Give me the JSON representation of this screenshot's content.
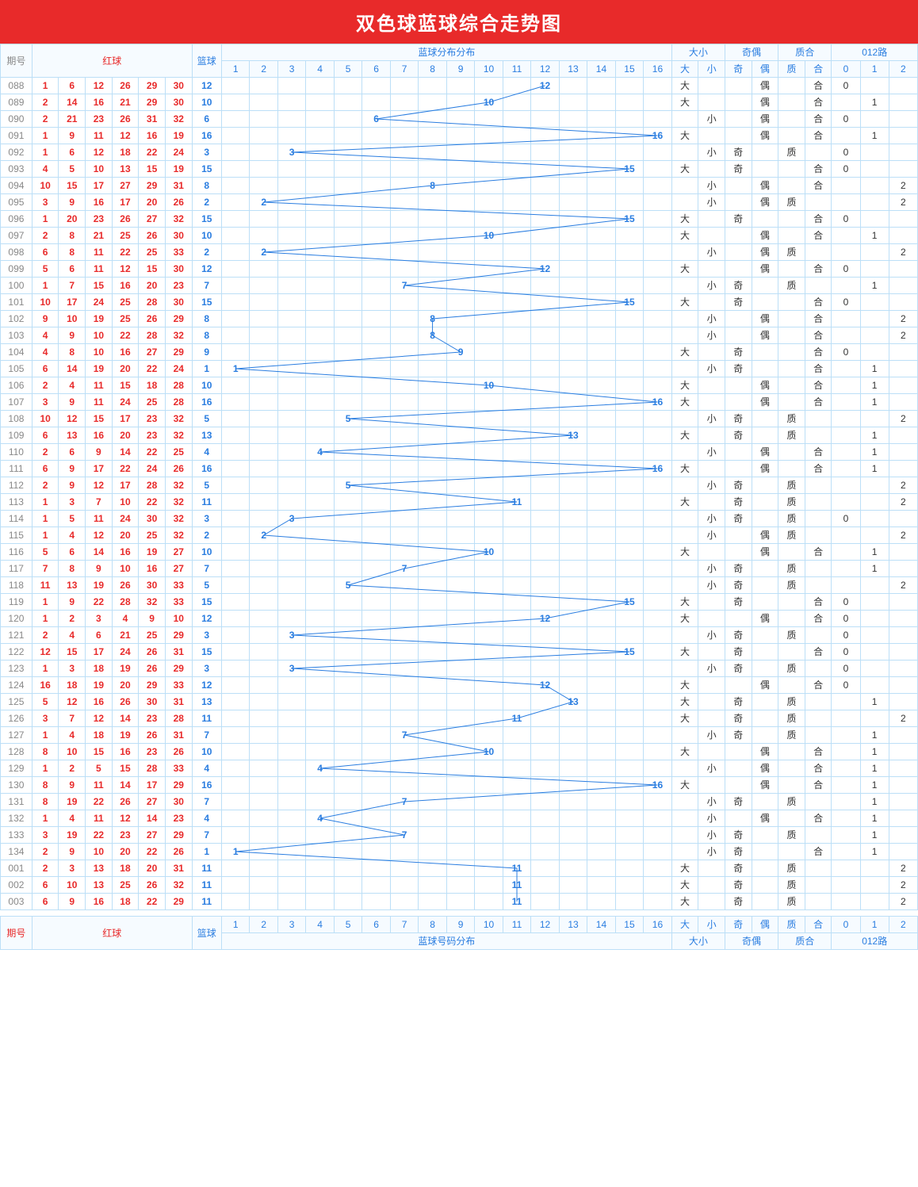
{
  "title": "双色球蓝球综合走势图",
  "headers": {
    "period": "期号",
    "red": "红球",
    "blue": "篮球",
    "distGroup": "蓝球分布分布",
    "distFooter": "蓝球号码分布",
    "dx": "大小",
    "dxBig": "大",
    "dxSmall": "小",
    "qo": "奇偶",
    "qoOdd": "奇",
    "qoEven": "偶",
    "zh": "质合",
    "zhPrime": "质",
    "zhComp": "合",
    "p012": "012路",
    "p0": "0",
    "p1": "1",
    "p2": "2"
  },
  "distCols": [
    "1",
    "2",
    "3",
    "4",
    "5",
    "6",
    "7",
    "8",
    "9",
    "10",
    "11",
    "12",
    "13",
    "14",
    "15",
    "16"
  ],
  "chart_data": {
    "type": "table",
    "title": "双色球蓝球综合走势图",
    "columns": [
      "期号",
      "红1",
      "红2",
      "红3",
      "红4",
      "红5",
      "红6",
      "蓝球",
      "大小",
      "奇偶",
      "质合",
      "012路"
    ],
    "rows": [
      {
        "period": "088",
        "red": [
          1,
          6,
          12,
          26,
          29,
          30
        ],
        "blue": 12,
        "dx": "大",
        "qo": "偶",
        "zh": "合",
        "p012": "0"
      },
      {
        "period": "089",
        "red": [
          2,
          14,
          16,
          21,
          29,
          30
        ],
        "blue": 10,
        "dx": "大",
        "qo": "偶",
        "zh": "合",
        "p012": "1"
      },
      {
        "period": "090",
        "red": [
          2,
          21,
          23,
          26,
          31,
          32
        ],
        "blue": 6,
        "dx": "小",
        "qo": "偶",
        "zh": "合",
        "p012": "0"
      },
      {
        "period": "091",
        "red": [
          1,
          9,
          11,
          12,
          16,
          19
        ],
        "blue": 16,
        "dx": "大",
        "qo": "偶",
        "zh": "合",
        "p012": "1"
      },
      {
        "period": "092",
        "red": [
          1,
          6,
          12,
          18,
          22,
          24
        ],
        "blue": 3,
        "dx": "小",
        "qo": "奇",
        "zh": "质",
        "p012": "0"
      },
      {
        "period": "093",
        "red": [
          4,
          5,
          10,
          13,
          15,
          19
        ],
        "blue": 15,
        "dx": "大",
        "qo": "奇",
        "zh": "合",
        "p012": "0"
      },
      {
        "period": "094",
        "red": [
          10,
          15,
          17,
          27,
          29,
          31
        ],
        "blue": 8,
        "dx": "小",
        "qo": "偶",
        "zh": "合",
        "p012": "2"
      },
      {
        "period": "095",
        "red": [
          3,
          9,
          16,
          17,
          20,
          26
        ],
        "blue": 2,
        "dx": "小",
        "qo": "偶",
        "zh": "质",
        "p012": "2"
      },
      {
        "period": "096",
        "red": [
          1,
          20,
          23,
          26,
          27,
          32
        ],
        "blue": 15,
        "dx": "大",
        "qo": "奇",
        "zh": "合",
        "p012": "0"
      },
      {
        "period": "097",
        "red": [
          2,
          8,
          21,
          25,
          26,
          30
        ],
        "blue": 10,
        "dx": "大",
        "qo": "偶",
        "zh": "合",
        "p012": "1"
      },
      {
        "period": "098",
        "red": [
          6,
          8,
          11,
          22,
          25,
          33
        ],
        "blue": 2,
        "dx": "小",
        "qo": "偶",
        "zh": "质",
        "p012": "2"
      },
      {
        "period": "099",
        "red": [
          5,
          6,
          11,
          12,
          15,
          30
        ],
        "blue": 12,
        "dx": "大",
        "qo": "偶",
        "zh": "合",
        "p012": "0"
      },
      {
        "period": "100",
        "red": [
          1,
          7,
          15,
          16,
          20,
          23
        ],
        "blue": 7,
        "dx": "小",
        "qo": "奇",
        "zh": "质",
        "p012": "1"
      },
      {
        "period": "101",
        "red": [
          10,
          17,
          24,
          25,
          28,
          30
        ],
        "blue": 15,
        "dx": "大",
        "qo": "奇",
        "zh": "合",
        "p012": "0"
      },
      {
        "period": "102",
        "red": [
          9,
          10,
          19,
          25,
          26,
          29
        ],
        "blue": 8,
        "dx": "小",
        "qo": "偶",
        "zh": "合",
        "p012": "2"
      },
      {
        "period": "103",
        "red": [
          4,
          9,
          10,
          22,
          28,
          32
        ],
        "blue": 8,
        "dx": "小",
        "qo": "偶",
        "zh": "合",
        "p012": "2"
      },
      {
        "period": "104",
        "red": [
          4,
          8,
          10,
          16,
          27,
          29
        ],
        "blue": 9,
        "dx": "大",
        "qo": "奇",
        "zh": "合",
        "p012": "0"
      },
      {
        "period": "105",
        "red": [
          6,
          14,
          19,
          20,
          22,
          24
        ],
        "blue": 1,
        "dx": "小",
        "qo": "奇",
        "zh": "合",
        "p012": "1"
      },
      {
        "period": "106",
        "red": [
          2,
          4,
          11,
          15,
          18,
          28
        ],
        "blue": 10,
        "dx": "大",
        "qo": "偶",
        "zh": "合",
        "p012": "1"
      },
      {
        "period": "107",
        "red": [
          3,
          9,
          11,
          24,
          25,
          28
        ],
        "blue": 16,
        "dx": "大",
        "qo": "偶",
        "zh": "合",
        "p012": "1"
      },
      {
        "period": "108",
        "red": [
          10,
          12,
          15,
          17,
          23,
          32
        ],
        "blue": 5,
        "dx": "小",
        "qo": "奇",
        "zh": "质",
        "p012": "2"
      },
      {
        "period": "109",
        "red": [
          6,
          13,
          16,
          20,
          23,
          32
        ],
        "blue": 13,
        "dx": "大",
        "qo": "奇",
        "zh": "质",
        "p012": "1"
      },
      {
        "period": "110",
        "red": [
          2,
          6,
          9,
          14,
          22,
          25
        ],
        "blue": 4,
        "dx": "小",
        "qo": "偶",
        "zh": "合",
        "p012": "1"
      },
      {
        "period": "111",
        "red": [
          6,
          9,
          17,
          22,
          24,
          26
        ],
        "blue": 16,
        "dx": "大",
        "qo": "偶",
        "zh": "合",
        "p012": "1"
      },
      {
        "period": "112",
        "red": [
          2,
          9,
          12,
          17,
          28,
          32
        ],
        "blue": 5,
        "dx": "小",
        "qo": "奇",
        "zh": "质",
        "p012": "2"
      },
      {
        "period": "113",
        "red": [
          1,
          3,
          7,
          10,
          22,
          32
        ],
        "blue": 11,
        "dx": "大",
        "qo": "奇",
        "zh": "质",
        "p012": "2"
      },
      {
        "period": "114",
        "red": [
          1,
          5,
          11,
          24,
          30,
          32
        ],
        "blue": 3,
        "dx": "小",
        "qo": "奇",
        "zh": "质",
        "p012": "0"
      },
      {
        "period": "115",
        "red": [
          1,
          4,
          12,
          20,
          25,
          32
        ],
        "blue": 2,
        "dx": "小",
        "qo": "偶",
        "zh": "质",
        "p012": "2"
      },
      {
        "period": "116",
        "red": [
          5,
          6,
          14,
          16,
          19,
          27
        ],
        "blue": 10,
        "dx": "大",
        "qo": "偶",
        "zh": "合",
        "p012": "1"
      },
      {
        "period": "117",
        "red": [
          7,
          8,
          9,
          10,
          16,
          27
        ],
        "blue": 7,
        "dx": "小",
        "qo": "奇",
        "zh": "质",
        "p012": "1"
      },
      {
        "period": "118",
        "red": [
          11,
          13,
          19,
          26,
          30,
          33
        ],
        "blue": 5,
        "dx": "小",
        "qo": "奇",
        "zh": "质",
        "p012": "2"
      },
      {
        "period": "119",
        "red": [
          1,
          9,
          22,
          28,
          32,
          33
        ],
        "blue": 15,
        "dx": "大",
        "qo": "奇",
        "zh": "合",
        "p012": "0"
      },
      {
        "period": "120",
        "red": [
          1,
          2,
          3,
          4,
          9,
          10
        ],
        "blue": 12,
        "dx": "大",
        "qo": "偶",
        "zh": "合",
        "p012": "0"
      },
      {
        "period": "121",
        "red": [
          2,
          4,
          6,
          21,
          25,
          29
        ],
        "blue": 3,
        "dx": "小",
        "qo": "奇",
        "zh": "质",
        "p012": "0"
      },
      {
        "period": "122",
        "red": [
          12,
          15,
          17,
          24,
          26,
          31
        ],
        "blue": 15,
        "dx": "大",
        "qo": "奇",
        "zh": "合",
        "p012": "0"
      },
      {
        "period": "123",
        "red": [
          1,
          3,
          18,
          19,
          26,
          29
        ],
        "blue": 3,
        "dx": "小",
        "qo": "奇",
        "zh": "质",
        "p012": "0"
      },
      {
        "period": "124",
        "red": [
          16,
          18,
          19,
          20,
          29,
          33
        ],
        "blue": 12,
        "dx": "大",
        "qo": "偶",
        "zh": "合",
        "p012": "0"
      },
      {
        "period": "125",
        "red": [
          5,
          12,
          16,
          26,
          30,
          31
        ],
        "blue": 13,
        "dx": "大",
        "qo": "奇",
        "zh": "质",
        "p012": "1"
      },
      {
        "period": "126",
        "red": [
          3,
          7,
          12,
          14,
          23,
          28
        ],
        "blue": 11,
        "dx": "大",
        "qo": "奇",
        "zh": "质",
        "p012": "2"
      },
      {
        "period": "127",
        "red": [
          1,
          4,
          18,
          19,
          26,
          31
        ],
        "blue": 7,
        "dx": "小",
        "qo": "奇",
        "zh": "质",
        "p012": "1"
      },
      {
        "period": "128",
        "red": [
          8,
          10,
          15,
          16,
          23,
          26
        ],
        "blue": 10,
        "dx": "大",
        "qo": "偶",
        "zh": "合",
        "p012": "1"
      },
      {
        "period": "129",
        "red": [
          1,
          2,
          5,
          15,
          28,
          33
        ],
        "blue": 4,
        "dx": "小",
        "qo": "偶",
        "zh": "合",
        "p012": "1"
      },
      {
        "period": "130",
        "red": [
          8,
          9,
          11,
          14,
          17,
          29
        ],
        "blue": 16,
        "dx": "大",
        "qo": "偶",
        "zh": "合",
        "p012": "1"
      },
      {
        "period": "131",
        "red": [
          8,
          19,
          22,
          26,
          27,
          30
        ],
        "blue": 7,
        "dx": "小",
        "qo": "奇",
        "zh": "质",
        "p012": "1"
      },
      {
        "period": "132",
        "red": [
          1,
          4,
          11,
          12,
          14,
          23
        ],
        "blue": 4,
        "dx": "小",
        "qo": "偶",
        "zh": "合",
        "p012": "1"
      },
      {
        "period": "133",
        "red": [
          3,
          19,
          22,
          23,
          27,
          29
        ],
        "blue": 7,
        "dx": "小",
        "qo": "奇",
        "zh": "质",
        "p012": "1"
      },
      {
        "period": "134",
        "red": [
          2,
          9,
          10,
          20,
          22,
          26
        ],
        "blue": 1,
        "dx": "小",
        "qo": "奇",
        "zh": "合",
        "p012": "1"
      },
      {
        "period": "001",
        "red": [
          2,
          3,
          13,
          18,
          20,
          31
        ],
        "blue": 11,
        "dx": "大",
        "qo": "奇",
        "zh": "质",
        "p012": "2"
      },
      {
        "period": "002",
        "red": [
          6,
          10,
          13,
          25,
          26,
          32
        ],
        "blue": 11,
        "dx": "大",
        "qo": "奇",
        "zh": "质",
        "p012": "2"
      },
      {
        "period": "003",
        "red": [
          6,
          9,
          16,
          18,
          22,
          29
        ],
        "blue": 11,
        "dx": "大",
        "qo": "奇",
        "zh": "质",
        "p012": "2"
      }
    ]
  }
}
